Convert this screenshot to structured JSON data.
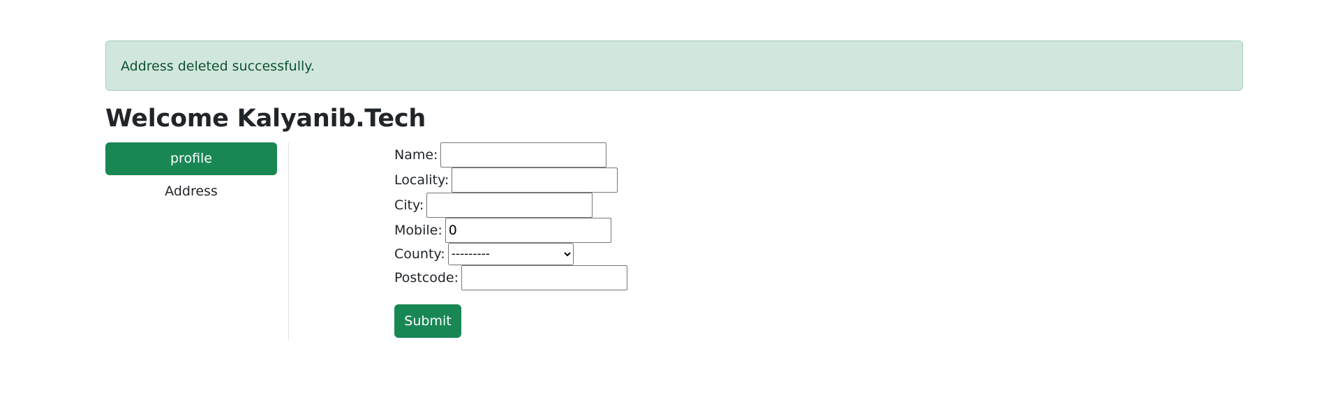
{
  "alert": {
    "message": "Address deleted successfully."
  },
  "header": {
    "welcome": "Welcome Kalyanib.Tech"
  },
  "sidebar": {
    "items": [
      {
        "label": "profile",
        "active": true
      },
      {
        "label": "Address",
        "active": false
      }
    ]
  },
  "form": {
    "name_label": "Name:",
    "name_value": "",
    "locality_label": "Locality:",
    "locality_value": "",
    "city_label": "City:",
    "city_value": "",
    "mobile_label": "Mobile:",
    "mobile_value": "0",
    "county_label": "County:",
    "county_selected": "---------",
    "postcode_label": "Postcode:",
    "postcode_value": "",
    "submit_label": "Submit"
  },
  "colors": {
    "accent": "#198754",
    "alert_bg": "#d1e7dd",
    "alert_text": "#0f5132"
  }
}
